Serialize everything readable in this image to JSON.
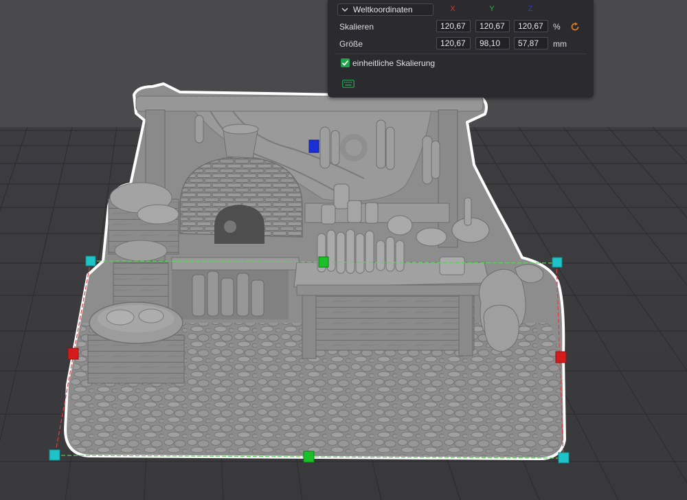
{
  "panel": {
    "coordinate_system": "Weltkoordinaten",
    "axes": {
      "x": {
        "label": "X",
        "color": "#e0332f"
      },
      "y": {
        "label": "Y",
        "color": "#1fbf3a"
      },
      "z": {
        "label": "Z",
        "color": "#2b3ddc"
      }
    },
    "scale": {
      "label": "Skalieren",
      "x": "120,67",
      "y": "120,67",
      "z": "120,67",
      "unit": "%"
    },
    "size": {
      "label": "Größe",
      "x": "120,67",
      "y": "98,10",
      "z": "57,87",
      "unit": "mm"
    },
    "uniform_scaling": {
      "label": "einheitliche Skalierung",
      "checked": true
    }
  },
  "icons": {
    "dropdown": "chevron-down-icon",
    "reset": "reset-scale-icon",
    "uniform_check": "checkmark-icon",
    "shortcuts": "keyboard-icon"
  },
  "colors": {
    "accent": "#1fa34a",
    "reset": "#e07a1f",
    "handle_corner": "#1ec3c8",
    "handle_x": "#d41c1c",
    "handle_y": "#1bbf2a",
    "handle_z": "#1a2fd6",
    "model": "#8f8f8f",
    "outline": "#ffffff"
  }
}
